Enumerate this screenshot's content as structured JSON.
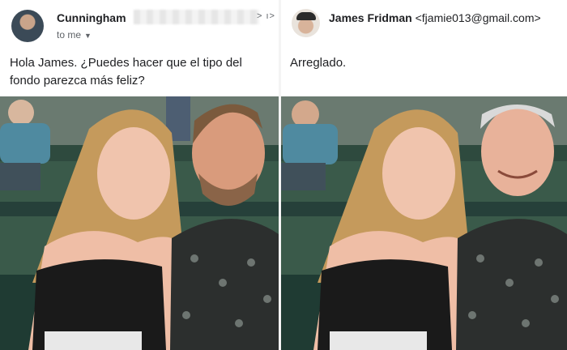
{
  "left_email": {
    "sender_name": "Cunningham",
    "to_line": "to me",
    "message": "Hola James. ¿Puedes hacer que el tipo del fondo parezca más feliz?"
  },
  "right_email": {
    "sender_name": "James Fridman",
    "sender_email": "<fjamie013@gmail.com>",
    "message": "Arreglado."
  }
}
